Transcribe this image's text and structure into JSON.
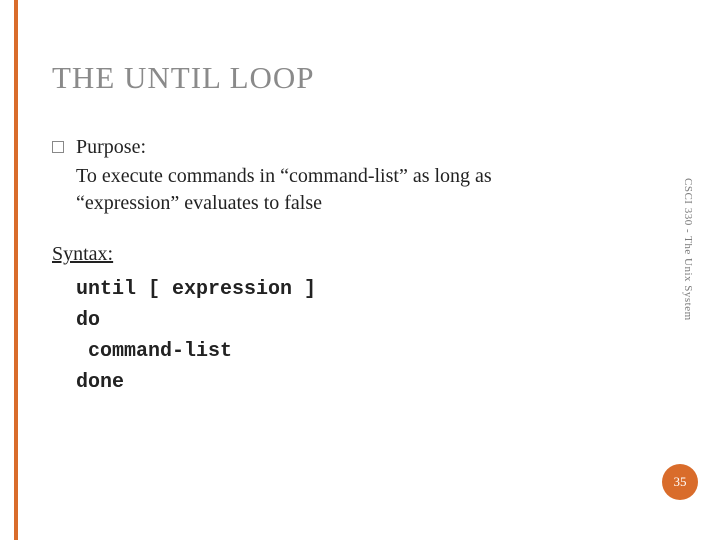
{
  "title": "THE UNTIL LOOP",
  "purpose_label": "Purpose:",
  "purpose_text": "To execute commands in “command-list” as long as “expression” evaluates to false",
  "syntax_label": "Syntax:",
  "code": "until [ expression ]\ndo\n command-list\ndone",
  "side_text": "CSCI 330 - The Unix System",
  "page_number": "35",
  "accent_color": "#d96c2b"
}
